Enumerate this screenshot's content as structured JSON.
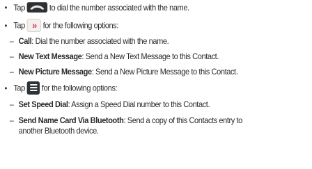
{
  "items": [
    {
      "bullet": "•",
      "pre": "Tap",
      "icon": "call-button-icon",
      "post": "to dial the number associated with the name."
    },
    {
      "bullet": "•",
      "pre": "Tap",
      "icon": "more-options-icon",
      "icon_glyph": "»",
      "post": "for the following options:"
    },
    {
      "dash": "–",
      "bold": "Call",
      "text": ": Dial the number associated with the name."
    },
    {
      "dash": "–",
      "bold": "New Text Message",
      "text": ": Send a New Text Message to this Contact."
    },
    {
      "dash": "–",
      "bold": "New Picture Message",
      "text": ": Send a New Picture Message to this Contact."
    },
    {
      "bullet": "•",
      "pre": "Tap",
      "icon": "menu-icon",
      "post": "for the following options:"
    },
    {
      "dash": "–",
      "bold": "Set Speed Dial",
      "text": ": Assign a Speed Dial number to this Contact."
    },
    {
      "dash": "–",
      "bold": "Send Name Card Via Bluetooth",
      "text": ": Send a copy of this Contacts entry to",
      "continuation": "another Bluetooth device."
    }
  ],
  "colors": {
    "text": "#2b2b2b",
    "accent": "#d63a6a",
    "icon_dark": "#2e3134"
  }
}
